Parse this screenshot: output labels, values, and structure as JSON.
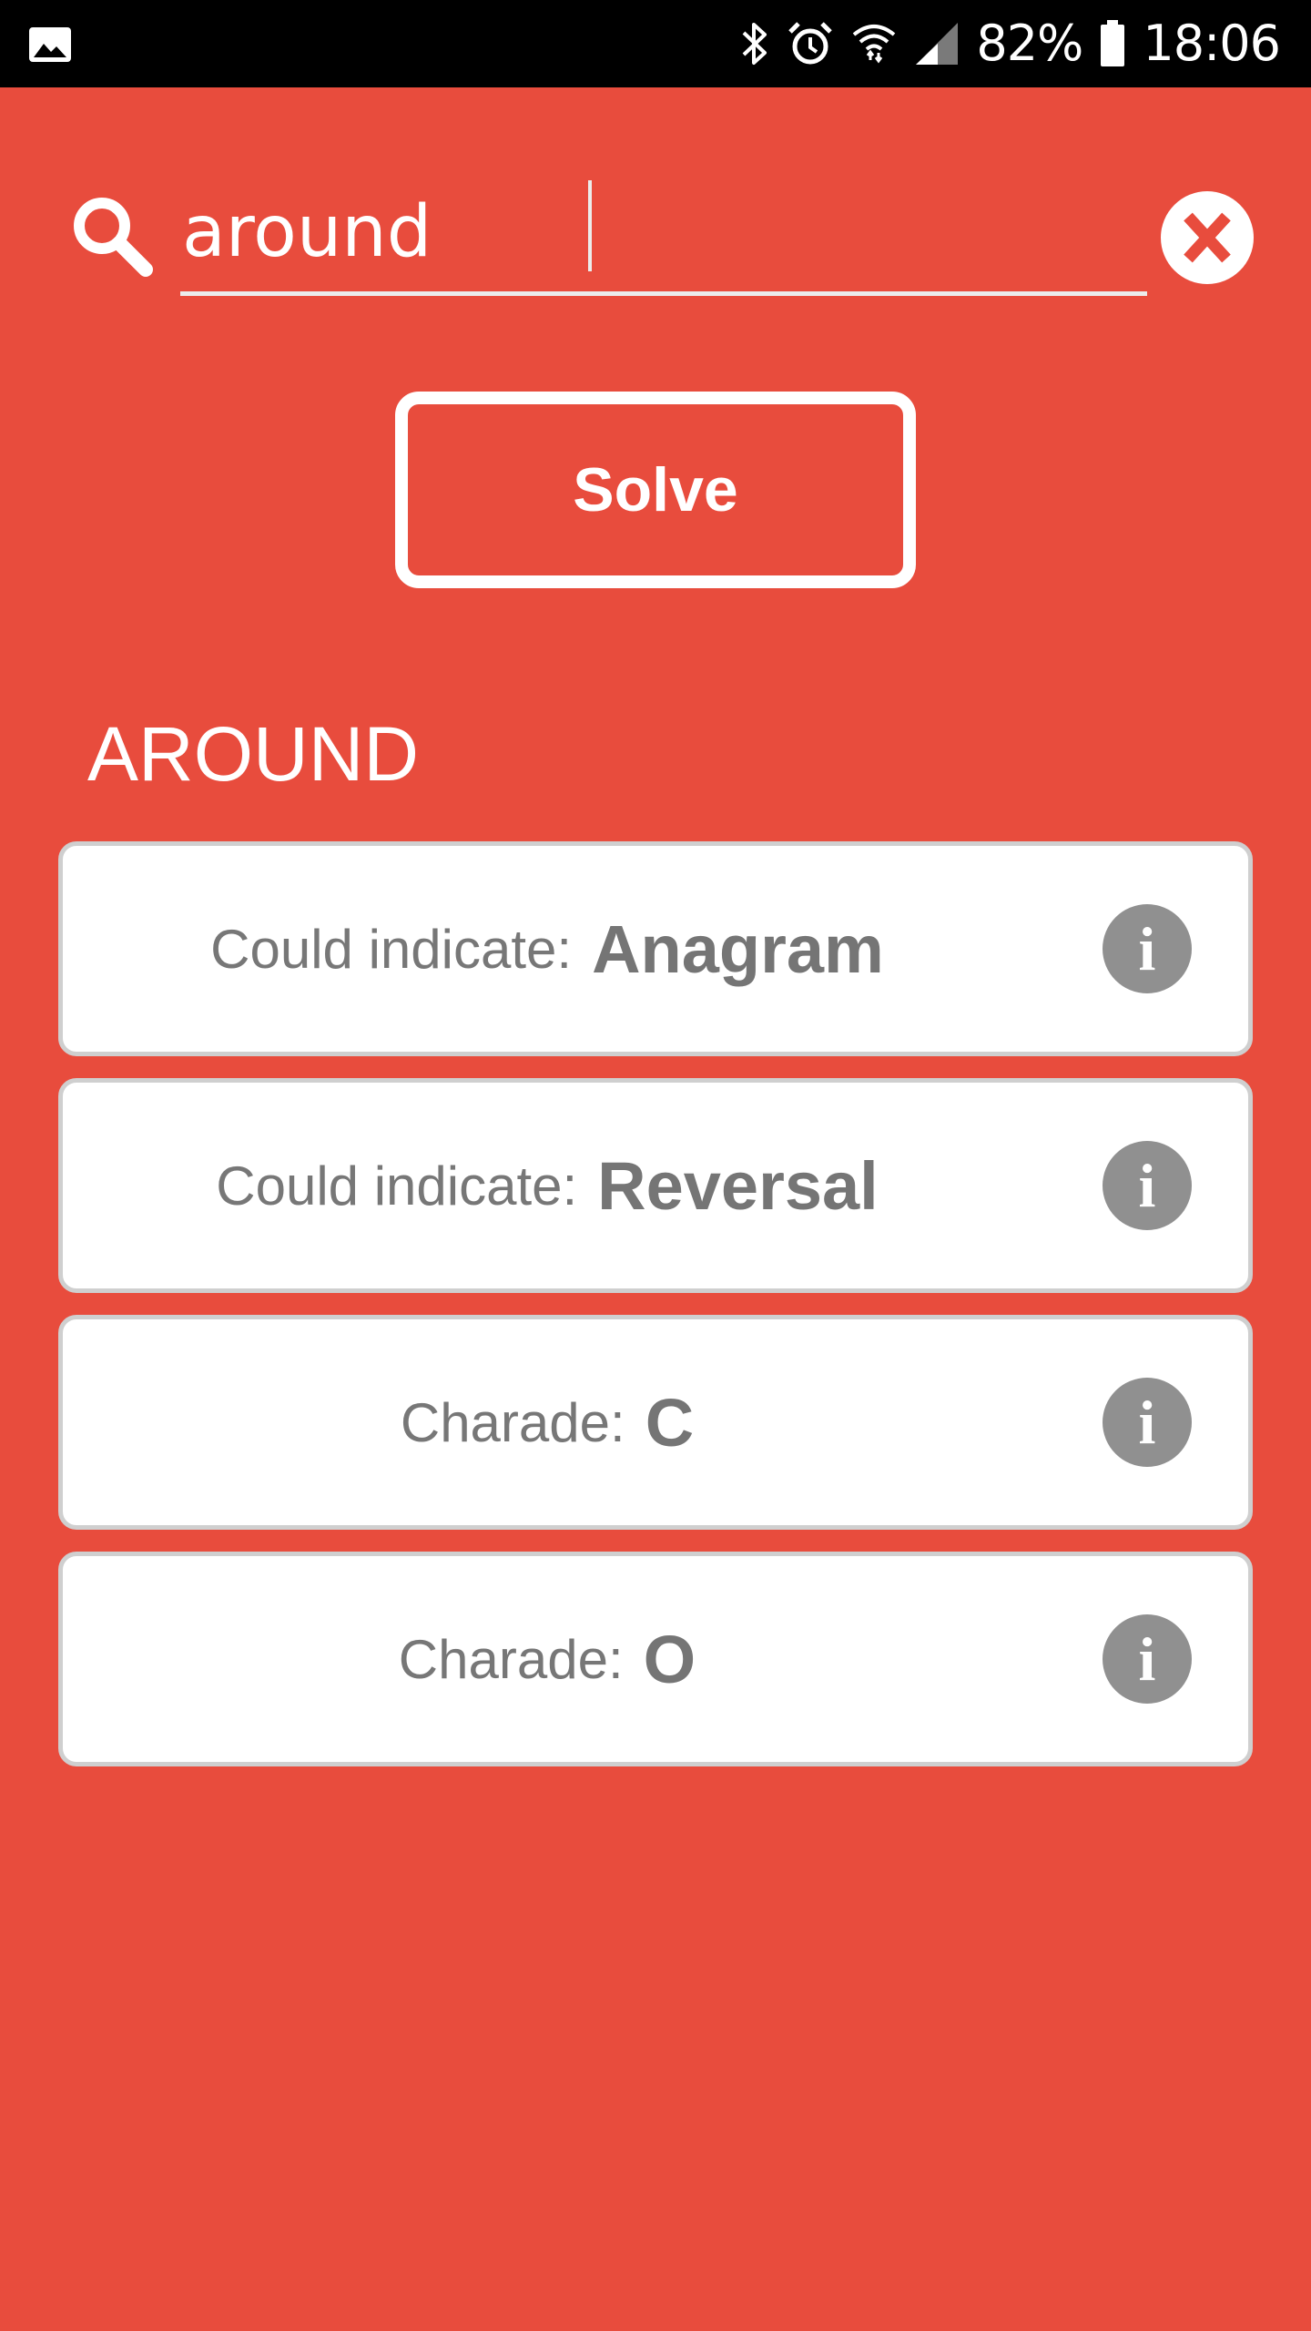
{
  "status_bar": {
    "icons": [
      "gallery-icon",
      "bluetooth-icon",
      "alarm-icon",
      "wifi-icon",
      "signal-icon",
      "battery-icon"
    ],
    "battery": "82%",
    "time": "18:06"
  },
  "search": {
    "value": "around",
    "icon": "search-icon",
    "clear_icon": "close-icon",
    "clear_label": "X"
  },
  "solve_label": "Solve",
  "word_heading": "AROUND",
  "results": [
    {
      "label": "Could indicate:",
      "value": "Anagram",
      "info": "i"
    },
    {
      "label": "Could indicate:",
      "value": "Reversal",
      "info": "i"
    },
    {
      "label": "Charade:",
      "value": "C",
      "info": "i"
    },
    {
      "label": "Charade:",
      "value": "O",
      "info": "i"
    }
  ],
  "colors": {
    "background": "#e84c3d",
    "card_background": "#ffffff",
    "card_border": "#cfcfcf",
    "text_gray": "#777777",
    "info_icon": "#909090",
    "status_bar": "#000000"
  }
}
